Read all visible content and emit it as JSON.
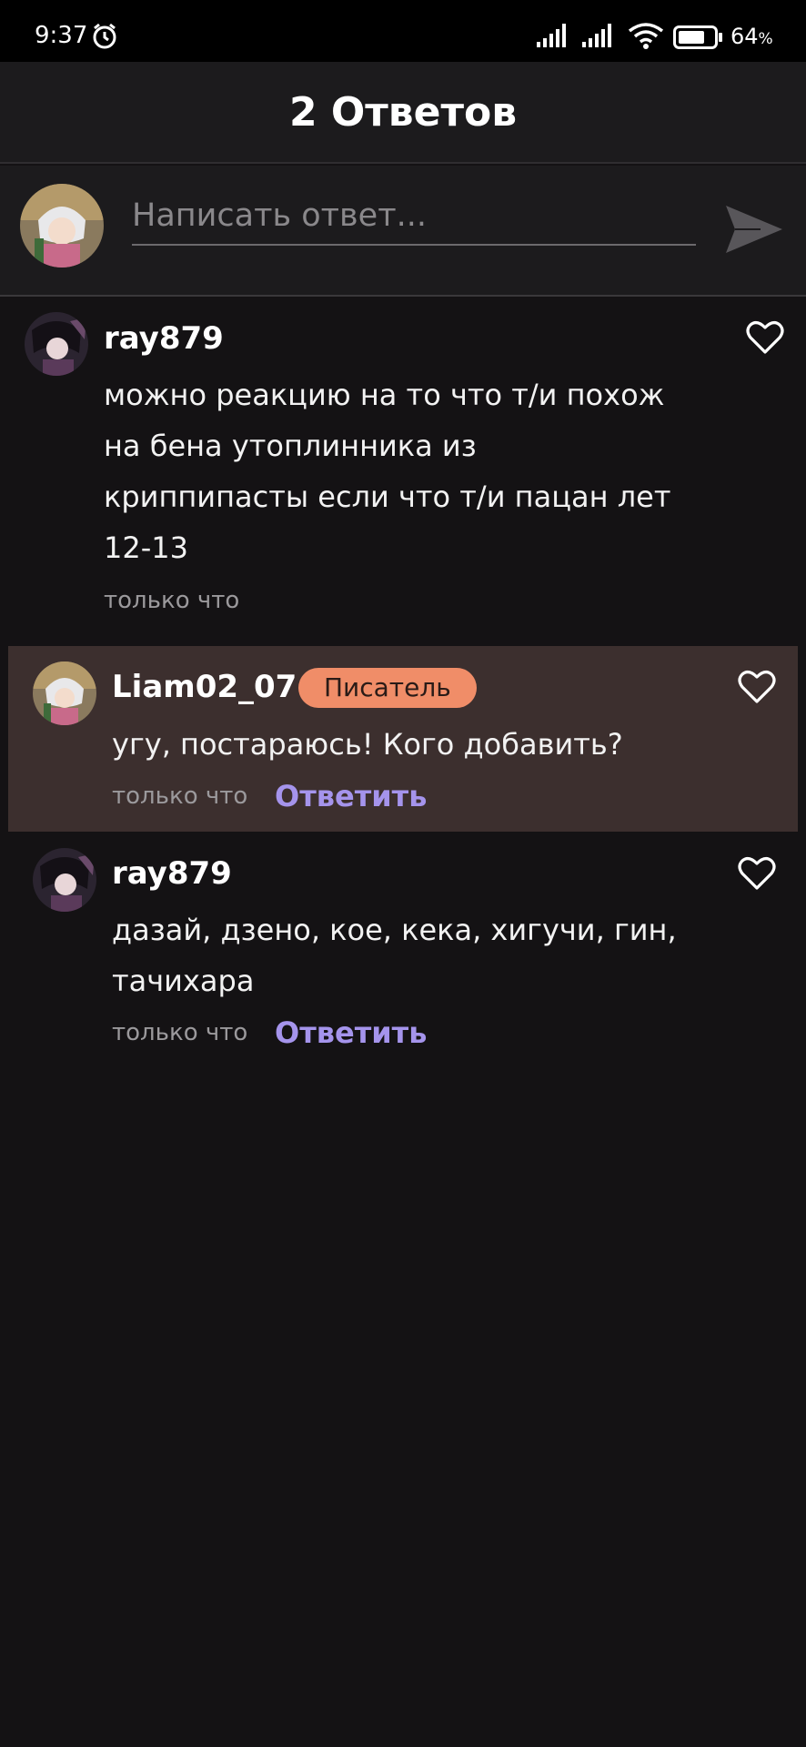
{
  "status_bar": {
    "time": "9:37",
    "battery_percent": "64",
    "battery_unit": "%"
  },
  "header": {
    "title": "2 Ответов"
  },
  "composer": {
    "placeholder": "Написать ответ..."
  },
  "comments": [
    {
      "username": "ray879",
      "text_lines": [
        "можно реакцию на то что т/и похож",
        "на бена утоплинника из",
        "криппипасты если что т/и пацан лет",
        "12-13"
      ],
      "timestamp": "только что"
    },
    {
      "username": "Liam02_07",
      "badge": "Писатель",
      "text_lines": [
        "угу, постараюсь! Кого добавить?"
      ],
      "timestamp": "только что",
      "reply_label": "Ответить"
    },
    {
      "username": "ray879",
      "text_lines": [
        "дазай, дзено, кое, кека, хигучи, гин,",
        "тачихара"
      ],
      "timestamp": "только что",
      "reply_label": "Ответить"
    }
  ],
  "colors": {
    "background": "#141214",
    "header": "#1c1b1d",
    "highlight": "#3c2f2e",
    "badge": "#f08d68",
    "link": "#a594ec"
  }
}
